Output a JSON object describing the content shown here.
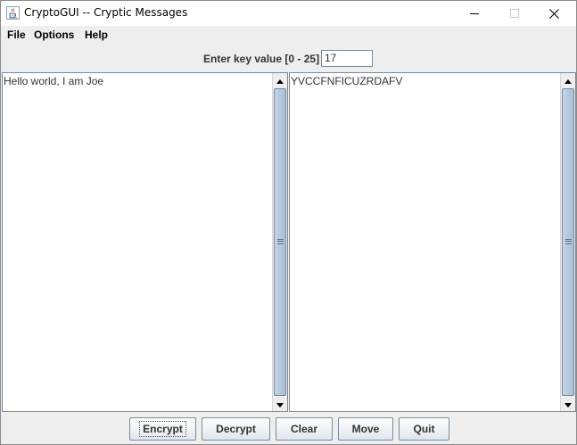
{
  "window": {
    "title": "CryptoGUI -- Cryptic Messages",
    "icons": {
      "app": "java-cup-icon",
      "minimize": "minimize-icon",
      "maximize": "maximize-icon",
      "close": "close-icon"
    }
  },
  "menu": {
    "items": [
      {
        "label": "File"
      },
      {
        "label": "Options"
      },
      {
        "label": "Help"
      }
    ]
  },
  "key": {
    "label": "Enter key value [0 - 25]",
    "value": "17"
  },
  "panes": {
    "input_text": "Hello world, I am Joe",
    "output_text": "YVCCFNFICUZRDAFV"
  },
  "buttons": {
    "encrypt": "Encrypt",
    "decrypt": "Decrypt",
    "clear": "Clear",
    "move": "Move",
    "quit": "Quit"
  },
  "colors": {
    "panel": "#eeeeee",
    "scroll_thumb": "#b8cbe0",
    "border": "#7a8a99"
  }
}
